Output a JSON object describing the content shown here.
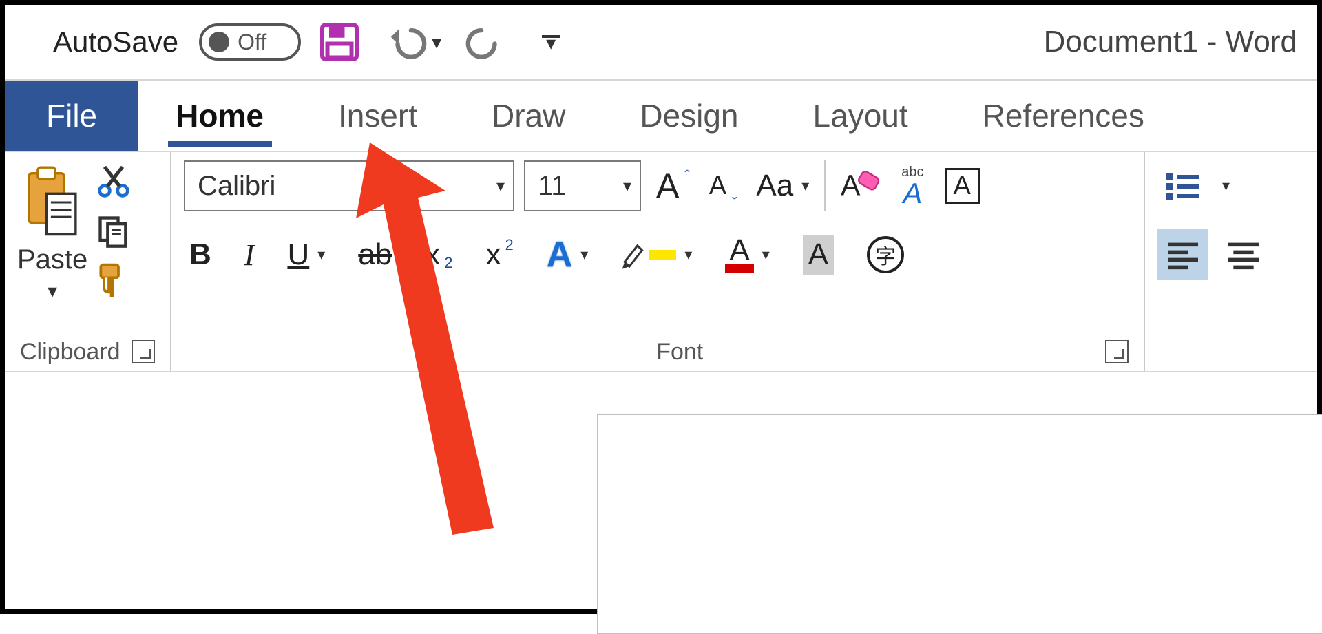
{
  "titlebar": {
    "autosave_label": "AutoSave",
    "autosave_state": "Off",
    "document_title": "Document1  -  Word"
  },
  "tabs": {
    "file": "File",
    "items": [
      "Home",
      "Insert",
      "Draw",
      "Design",
      "Layout",
      "References"
    ],
    "active_index": 0
  },
  "ribbon": {
    "clipboard": {
      "group_label": "Clipboard",
      "paste_label": "Paste"
    },
    "font": {
      "group_label": "Font",
      "font_name": "Calibri",
      "font_size": "11",
      "change_case_label": "Aa",
      "bold": "B",
      "italic": "I",
      "underline": "U",
      "strike": "ab",
      "subscript_base": "x",
      "subscript_sub": "2",
      "superscript_base": "x",
      "superscript_sup": "2",
      "text_effect": "A",
      "highlight": "A",
      "font_color": "A",
      "shading": "A",
      "char_border": "A",
      "phonetic": "字",
      "clear_fmt_prefix": "abc"
    },
    "paragraph": {}
  },
  "annotation": {
    "points_to_tab": "Insert"
  }
}
